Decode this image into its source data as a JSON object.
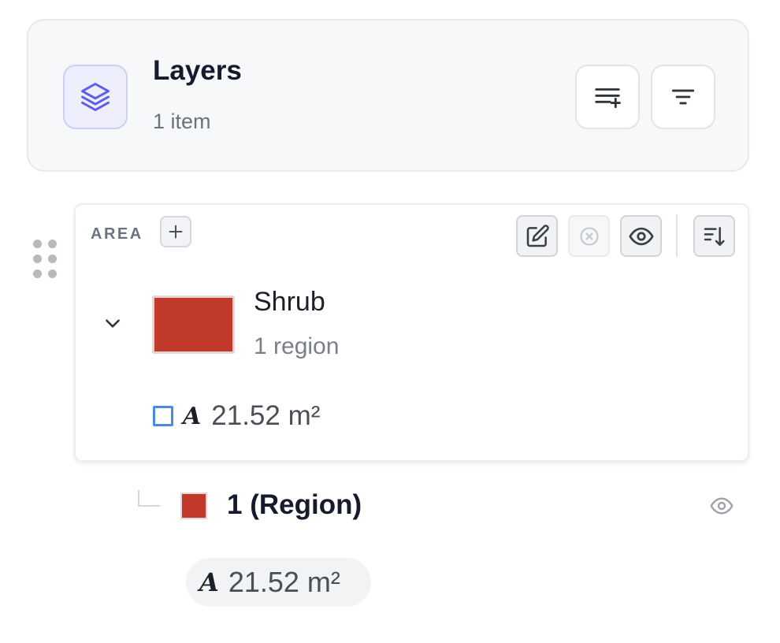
{
  "header": {
    "title": "Layers",
    "subtitle": "1 item",
    "icons": {
      "badge": "layers-stack-icon",
      "add_list": "list-add-icon",
      "filter": "filter-icon"
    }
  },
  "area_panel": {
    "label": "AREA",
    "add_icon": "plus-icon",
    "tools": [
      "edit-icon",
      "clear-icon",
      "eye-icon",
      "sort-desc-icon"
    ],
    "layer": {
      "name": "Shrub",
      "count": "1 region",
      "color": "#c0392b",
      "measure_symbol": "A",
      "measure_value": "21.52 m²"
    }
  },
  "region": {
    "name": "1 (Region)",
    "color": "#c0392b",
    "measure_symbol": "A",
    "measure_value": "21.52 m²"
  },
  "colors": {
    "accent": "#6366f1",
    "checkbox": "#4a8ae6"
  }
}
